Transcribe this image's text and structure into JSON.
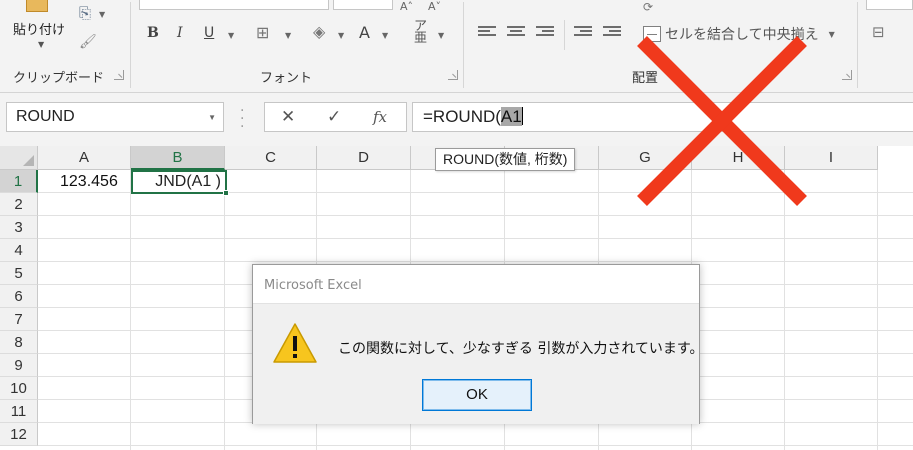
{
  "ribbon": {
    "paste_label": "貼り付け",
    "clipboard_group": "クリップボード",
    "font_group": "フォント",
    "alignment_group": "配置",
    "merge_center_label": "セルを結合して中央揃え",
    "bold": "B",
    "italic": "I",
    "underline": "U",
    "font_color": "A"
  },
  "formula_bar": {
    "name_box": "ROUND",
    "cancel_glyph": "✕",
    "enter_glyph": "✓",
    "fx_glyph": "fx",
    "formula_prefix": "=ROUND(",
    "formula_ref": "A1"
  },
  "grid": {
    "columns": [
      "A",
      "B",
      "C",
      "D",
      "E",
      "F",
      "G",
      "H",
      "I"
    ],
    "rows": [
      "1",
      "2",
      "3",
      "4",
      "5",
      "6",
      "7",
      "8",
      "9",
      "10",
      "11",
      "12"
    ],
    "a1_value": "123.456",
    "b1_edit": "JND(A1 )"
  },
  "tooltip": "ROUND(数値, 桁数)",
  "dialog": {
    "title": "Microsoft Excel",
    "message": "この関数に対して、少なすぎる 引数が入力されています。",
    "ok_label": "OK"
  },
  "colors": {
    "excel_green": "#217346",
    "big_x": "#f0391c",
    "warning_yellow": "#f7c51e"
  }
}
